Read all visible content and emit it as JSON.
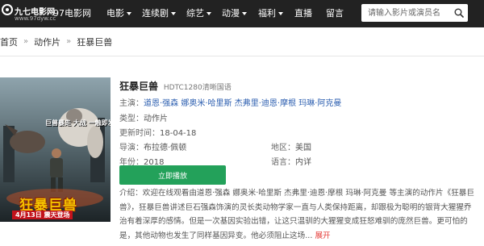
{
  "header": {
    "logo_text": "九七电影网",
    "logo_url": "www.97dyw.cc",
    "site_name": "97电影网",
    "nav": [
      {
        "label": "电影",
        "dropdown": true
      },
      {
        "label": "连续剧",
        "dropdown": true
      },
      {
        "label": "综艺",
        "dropdown": true
      },
      {
        "label": "动漫",
        "dropdown": true
      },
      {
        "label": "福利",
        "dropdown": true
      },
      {
        "label": "直播",
        "dropdown": false
      },
      {
        "label": "留言",
        "dropdown": false
      }
    ],
    "search_placeholder": "请输入影片或演员名",
    "search_icon": "search-icon"
  },
  "breadcrumb": {
    "home": "首页",
    "category": "动作片",
    "current": "狂暴巨兽",
    "separator": "»"
  },
  "poster": {
    "title": "狂暴巨兽",
    "tagline": "巨兽暴走 大战 一触即发",
    "release": "4月13日 震天登场"
  },
  "movie": {
    "title": "狂暴巨兽",
    "quality": "HDTC1280清晰国语",
    "cast_label": "主演：",
    "cast": "道恩·强森 娜奥米·哈里斯 杰弗里·迪恩·摩根 玛琳·阿克曼",
    "type_label": "类型：",
    "type": "动作片",
    "updated_label": "更新时间：",
    "updated": "18-04-18",
    "director_label": "导演：",
    "director": "布拉德·佩顿",
    "region_label": "地区：",
    "region": "美国",
    "year_label": "年份：",
    "year": "2018",
    "language_label": "语言：",
    "language": "内详",
    "play_button": "立即播放",
    "desc_label": "介绍：",
    "description": "欢迎在线观看由道恩·强森 娜奥米·哈里斯 杰弗里·迪恩·摩根 玛琳·阿克曼 等主演的动作片《狂暴巨兽》，狂暴巨兽讲述巨石强森饰演的灵长类动物学家一直与人类保持距离，却跟极为聪明的银背大猩猩乔治有着深厚的感情。但是一次基因实验出错，让这只温驯的大猩猩变成狂怒难驯的庞然巨兽。更可怕的是，其他动物也发生了同样基因异变。他必须阻止这场...",
    "more": "展开"
  }
}
